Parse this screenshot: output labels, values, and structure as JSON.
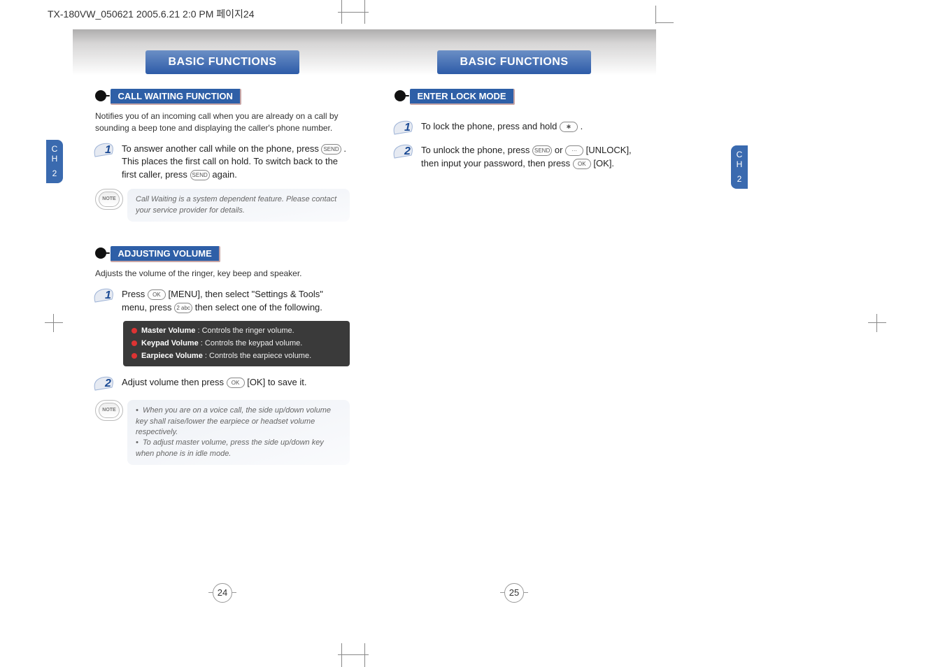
{
  "header_line": "TX-180VW_050621  2005.6.21 2:0 PM  페이지24",
  "chapter_tab": {
    "line1": "C",
    "line2": "H",
    "line3": "2"
  },
  "left": {
    "title": "BASIC FUNCTIONS",
    "section1_label": "CALL WAITING FUNCTION",
    "section1_desc": "Notifies you of an incoming call when you are already on a call by sounding a beep tone and displaying the caller's phone number.",
    "step1_num": "1",
    "step1_txt_a": "To answer another call while on the phone, press ",
    "step1_txt_b": " . This places the first call on hold. To switch back to the first caller, press ",
    "step1_txt_c": " again.",
    "note1": "Call Waiting is a system dependent feature. Please contact your service provider for details.",
    "section2_label": "ADJUSTING VOLUME",
    "section2_desc": "Adjusts the volume of the ringer, key beep and speaker.",
    "s2_step1_num": "1",
    "s2_step1_a": "Press ",
    "s2_step1_b": " [MENU], then select \"Settings & Tools\" menu, press ",
    "s2_step1_c": " then select one of the following.",
    "vol_items": {
      "master_b": "Master Volume",
      "master_t": " : Controls the ringer volume.",
      "keypad_b": "Keypad Volume",
      "keypad_t": " : Controls the keypad volume.",
      "earpiece_b": "Earpiece Volume",
      "earpiece_t": " : Controls the earpiece volume."
    },
    "s2_step2_num": "2",
    "s2_step2_a": "Adjust volume then press ",
    "s2_step2_b": " [OK] to save it.",
    "note2_l1": "When you are on a voice call, the side up/down volume key shall raise/lower the earpiece or headset volume respectively.",
    "note2_l2": "To adjust master volume, press the side up/down key when phone is in idle mode.",
    "page_number": "24"
  },
  "right": {
    "title": "BASIC FUNCTIONS",
    "section1_label": "ENTER LOCK MODE",
    "step1_num": "1",
    "step1_a": "To lock the phone, press and hold ",
    "step1_b": " .",
    "step2_num": "2",
    "step2_a": "To unlock the phone, press ",
    "step2_b": " or ",
    "step2_c": " [UNLOCK], then input your password, then press ",
    "step2_d": " [OK].",
    "page_number": "25"
  },
  "keys": {
    "send": "SEND",
    "ok": "OK",
    "two": "2 abc",
    "star": "✱",
    "soft": "···"
  }
}
